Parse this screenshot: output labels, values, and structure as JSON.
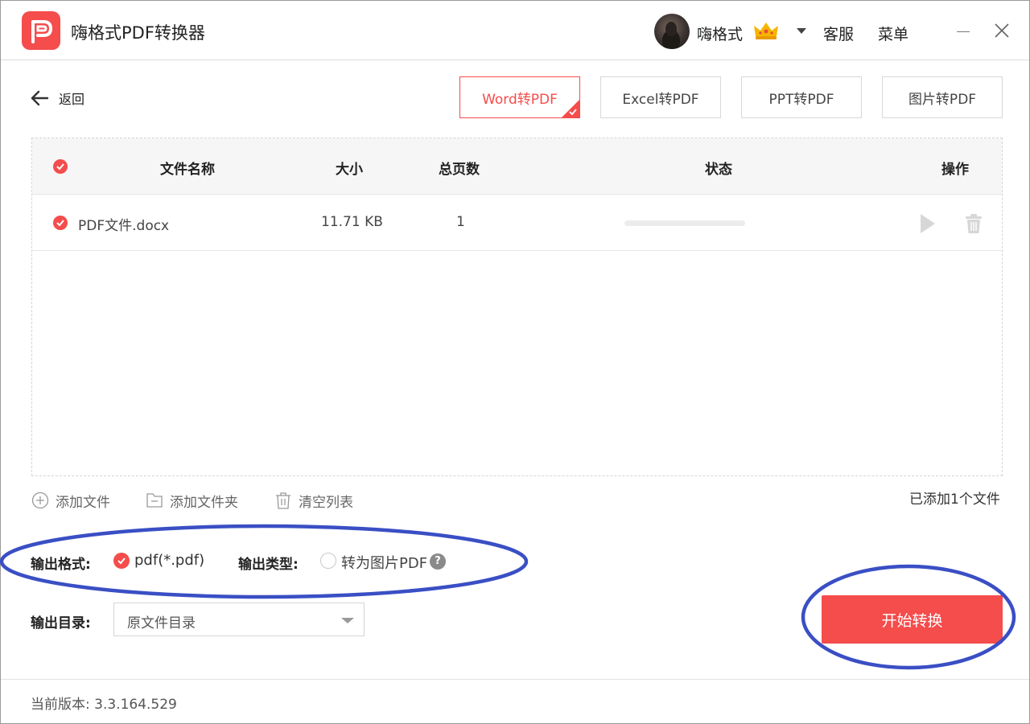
{
  "header": {
    "app_title": "嗨格式PDF转换器",
    "username": "嗨格式",
    "service_label": "客服",
    "menu_label": "菜单",
    "brand_color": "#f54c4c"
  },
  "nav": {
    "back_label": "返回"
  },
  "tabs": [
    {
      "label": "Word转PDF",
      "active": true
    },
    {
      "label": "Excel转PDF",
      "active": false
    },
    {
      "label": "PPT转PDF",
      "active": false
    },
    {
      "label": "图片转PDF",
      "active": false
    }
  ],
  "table": {
    "columns": {
      "name": "文件名称",
      "size": "大小",
      "pages": "总页数",
      "status": "状态",
      "actions": "操作"
    },
    "rows": [
      {
        "name": "PDF文件.docx",
        "size": "11.71 KB",
        "pages": "1",
        "progress": 0
      }
    ]
  },
  "actions": {
    "add_file": "添加文件",
    "add_folder": "添加文件夹",
    "clear_list": "清空列表",
    "file_count": "已添加1个文件"
  },
  "output": {
    "format_label": "输出格式:",
    "format_value": "pdf(*.pdf)",
    "type_label": "输出类型:",
    "type_option": "转为图片PDF",
    "type_help": "?",
    "dir_label": "输出目录:",
    "dir_value": "原文件目录"
  },
  "start_label": "开始转换",
  "footer": {
    "version": "当前版本: 3.3.164.529"
  },
  "icons": {
    "logo": "app-logo-icon",
    "crown": "crown-icon",
    "back": "arrow-left-icon",
    "play": "play-icon",
    "trash": "trash-icon",
    "add": "plus-circle-icon",
    "folder": "folder-icon",
    "clear": "trash-icon"
  },
  "annotation_color": "#3a4fc4"
}
